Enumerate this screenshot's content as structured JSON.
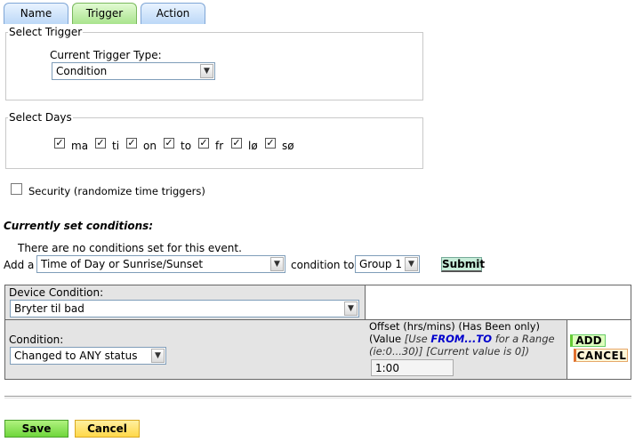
{
  "tabs": [
    {
      "label": "Name"
    },
    {
      "label": "Trigger"
    },
    {
      "label": "Action"
    }
  ],
  "select_trigger": {
    "legend": "Select Trigger",
    "type_label": "Current Trigger Type:",
    "type_value": "Condition"
  },
  "select_days": {
    "legend": "Select Days",
    "days": [
      {
        "label": "ma",
        "checked": true
      },
      {
        "label": "ti",
        "checked": true
      },
      {
        "label": "on",
        "checked": true
      },
      {
        "label": "to",
        "checked": true
      },
      {
        "label": "fr",
        "checked": true
      },
      {
        "label": "lø",
        "checked": true
      },
      {
        "label": "sø",
        "checked": true
      }
    ]
  },
  "security": {
    "label": "Security (randomize time triggers)",
    "checked": false
  },
  "conditions": {
    "heading": "Currently set conditions:",
    "empty_text": "There are no conditions set for this event.",
    "add_prefix": "Add a",
    "add_type": "Time of Day or Sunrise/Sunset",
    "condition_to": "condition to",
    "group": "Group 1",
    "submit": "Submit"
  },
  "editor": {
    "device_label": "Device Condition:",
    "device_value": "Bryter til bad",
    "condition_label": "Condition:",
    "condition_value": "Changed to ANY status",
    "offset_title": "Offset (hrs/mins) (Has Been only)",
    "offset_hint_1": "(Value ",
    "offset_hint_2": "[Use ",
    "offset_hint_3": "FROM...TO",
    "offset_hint_4": " for a Range",
    "offset_hint_5": "(ie:0...30)] [Current value is 0])",
    "offset_value": "1:00",
    "add": "ADD",
    "cancel": "CANCEL"
  },
  "footer": {
    "save": "Save",
    "cancel": "Cancel"
  },
  "colors": {
    "tab_blue": "#bcd8f7",
    "tab_green": "#a9e48d",
    "save_green": "#7fe04a",
    "cancel_yellow": "#ffe066",
    "link_blue": "#0000cc"
  }
}
